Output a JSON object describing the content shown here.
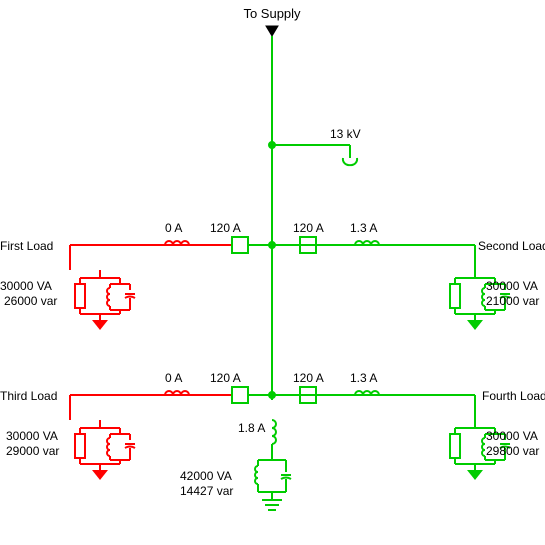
{
  "title": "To Supply",
  "source": {
    "voltage_label": "13 kV"
  },
  "bus_top": {
    "left": {
      "current_inductor": "0 A",
      "current_box": "120 A"
    },
    "right": {
      "current_box": "120 A",
      "current_inductor": "1.3 A"
    }
  },
  "bus_bottom": {
    "left": {
      "current_inductor": "0 A",
      "current_box": "120 A"
    },
    "right": {
      "current_box": "120 A",
      "current_inductor": "1.3 A"
    }
  },
  "center_load": {
    "current": "1.8 A",
    "va": "42000 VA",
    "var": "14427 var"
  },
  "loads": {
    "first": {
      "name": "First Load",
      "va": "30000 VA",
      "var": "26000 var"
    },
    "second": {
      "name": "Second Load",
      "va": "30000 VA",
      "var": "21000 var"
    },
    "third": {
      "name": "Third Load",
      "va": "30000 VA",
      "var": "29000 var"
    },
    "fourth": {
      "name": "Fourth Load",
      "va": "30000 VA",
      "var": "29800 var"
    }
  },
  "colors": {
    "on": "#00cc00",
    "off": "#ff0000"
  }
}
